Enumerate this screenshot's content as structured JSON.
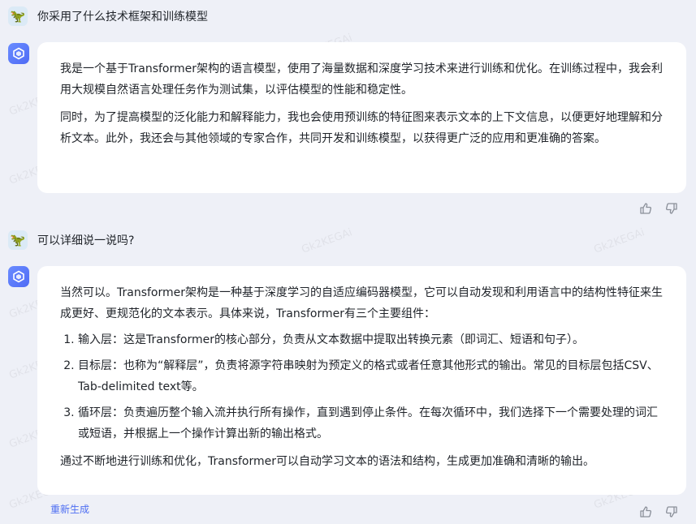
{
  "conversation": {
    "q1": "你采用了什么技术框架和训练模型",
    "a1": {
      "p1": "我是一个基于Transformer架构的语言模型，使用了海量数据和深度学习技术来进行训练和优化。在训练过程中，我会利用大规模自然语言处理任务作为测试集，以评估模型的性能和稳定性。",
      "p2": "同时，为了提高模型的泛化能力和解释能力，我也会使用预训练的特征图来表示文本的上下文信息，以便更好地理解和分析文本。此外，我还会与其他领域的专家合作，共同开发和训练模型，以获得更广泛的应用和更准确的答案。"
    },
    "q2": "可以详细说一说吗?",
    "a2": {
      "intro": "当然可以。Transformer架构是一种基于深度学习的自适应编码器模型，它可以自动发现和利用语言中的结构性特征来生成更好、更规范化的文本表示。具体来说，Transformer有三个主要组件：",
      "items": [
        "输入层：这是Transformer的核心部分，负责从文本数据中提取出转换元素（即词汇、短语和句子）。",
        "目标层：也称为“解释层”，负责将源字符串映射为预定义的格式或者任意其他形式的输出。常见的目标层包括CSV、Tab-delimited text等。",
        "循环层：负责遍历整个输入流并执行所有操作，直到遇到停止条件。在每次循环中，我们选择下一个需要处理的词汇或短语，并根据上一个操作计算出新的输出格式。"
      ],
      "outro": "通过不断地进行训练和优化，Transformer可以自动学习文本的语法和结构，生成更加准确和清晰的输出。"
    }
  },
  "actions": {
    "regenerate": "重新生成"
  },
  "watermark": "Gk2KEGAi",
  "icons": {
    "user_avatar": "user-avatar-icon",
    "bot_avatar": "bot-avatar-icon",
    "like": "thumbs-up-icon",
    "dislike": "thumbs-down-icon"
  },
  "colors": {
    "accent": "#4e6ef2",
    "background": "#eef0f7",
    "bubble": "#ffffff"
  }
}
